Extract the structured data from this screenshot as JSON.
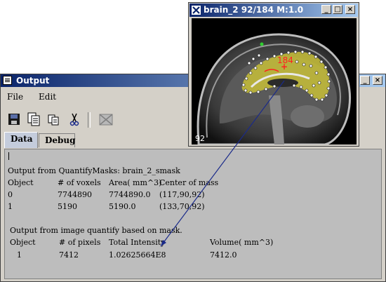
{
  "output_window": {
    "title": "Output",
    "menu": [
      "File",
      "Edit"
    ],
    "toolbar_icons": [
      "save-icon",
      "copy-icon",
      "paste-icon",
      "cut-icon",
      "clear-icon"
    ],
    "tabs": [
      "Data",
      "Debug"
    ],
    "active_tab": "Data",
    "content": {
      "section1_title": "Output from QuantifyMasks: brain_2_smask",
      "table1_headers": [
        "Object",
        "# of voxels",
        "Area( mm^3)",
        "Center of mass"
      ],
      "table1_rows": [
        [
          "0",
          "7744890",
          "7744890.0",
          "(117,90,92)"
        ],
        [
          "1",
          "5190",
          "5190.0",
          "(133,70,92)"
        ]
      ],
      "section2_title": "Output from image quantify based on mask.",
      "table2_headers": [
        "Object",
        "# of pixels",
        "Total Intensity",
        "Volume( mm^3)"
      ],
      "table2_rows": [
        [
          "1",
          "7412",
          "1.02625664E8",
          "7412.0"
        ]
      ]
    }
  },
  "image_window": {
    "title": "brain_2  92/184 M:1.0",
    "slice_label": "92",
    "marker_label": "184"
  },
  "colors": {
    "titlebar_start": "#0a246a",
    "titlebar_end": "#a6caf0",
    "mask_fill": "#c8c038",
    "marker_red": "#ff2020",
    "annotation_arrow": "#1a2a8a"
  }
}
